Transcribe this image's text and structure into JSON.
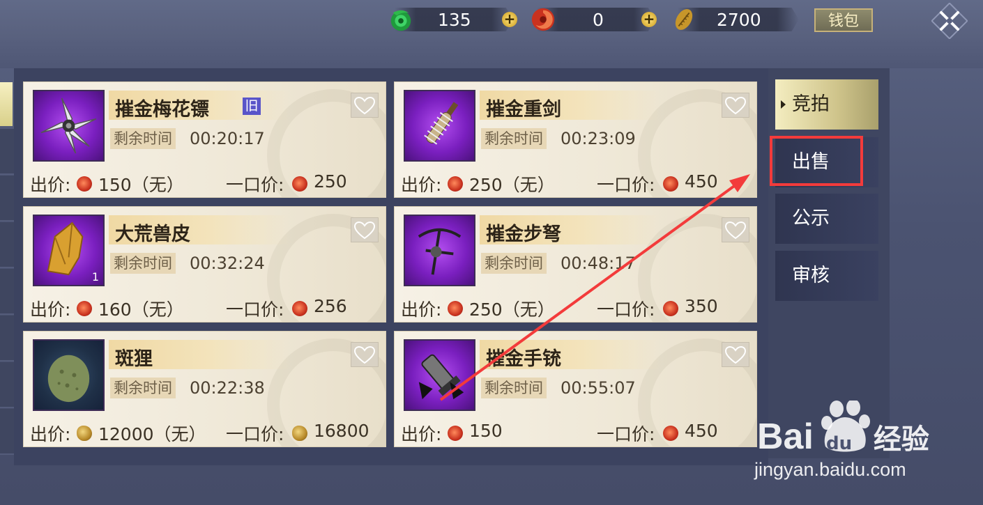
{
  "currencies": [
    {
      "name": "jade",
      "icon": "jade-currency-icon",
      "value": "135",
      "color": "#2fb84c"
    },
    {
      "name": "red-coin",
      "icon": "red-coin-currency-icon",
      "value": "0",
      "color": "#d2462b"
    },
    {
      "name": "gold-shell",
      "icon": "gold-shell-currency-icon",
      "value": "2700",
      "color": "#c7962a"
    }
  ],
  "wallet_label": "钱包",
  "labels": {
    "remaining": "剩余时间",
    "bid": "出价:",
    "buyout": "一口价:"
  },
  "side_tabs": [
    {
      "label": "竞拍",
      "active": true
    },
    {
      "label": "出售",
      "active": false,
      "highlighted": true
    },
    {
      "label": "公示",
      "active": false
    },
    {
      "label": "审核",
      "active": false
    }
  ],
  "items": [
    {
      "name": "摧金梅花镖",
      "badge": "旧",
      "time": "00:20:17",
      "bid": "150（无）",
      "buyout": "250",
      "coin": "red",
      "icon": "shuriken-icon"
    },
    {
      "name": "摧金重剑",
      "badge": "",
      "time": "00:23:09",
      "bid": "250（无）",
      "buyout": "450",
      "coin": "red",
      "icon": "spiked-club-icon"
    },
    {
      "name": "大荒兽皮",
      "badge": "",
      "time": "00:32:24",
      "bid": "160（无）",
      "buyout": "256",
      "coin": "red",
      "qty": "1",
      "icon": "beast-hide-icon"
    },
    {
      "name": "摧金步弩",
      "badge": "",
      "time": "00:48:17",
      "bid": "250（无）",
      "buyout": "350",
      "coin": "red",
      "icon": "crossbow-icon"
    },
    {
      "name": "斑狸",
      "badge": "",
      "time": "00:22:38",
      "bid": "12000（无）",
      "buyout": "16800",
      "coin": "gold",
      "icon": "spotted-egg-icon"
    },
    {
      "name": "摧金手铳",
      "badge": "",
      "time": "00:55:07",
      "bid": "150",
      "buyout": "450",
      "coin": "red",
      "icon": "hand-cannon-icon"
    }
  ],
  "watermark": {
    "brand_a": "Bai",
    "brand_b": "du",
    "brand_cn": "经验",
    "url": "jingyan.baidu.com"
  }
}
